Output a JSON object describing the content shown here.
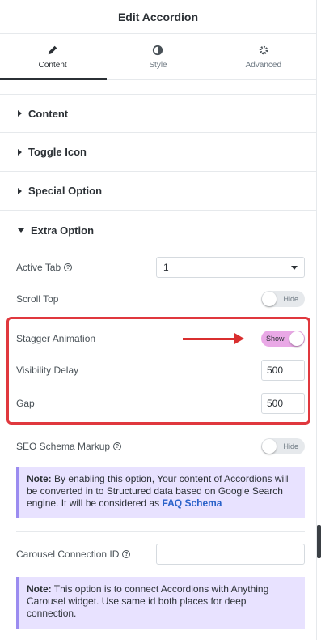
{
  "header": {
    "title": "Edit Accordion"
  },
  "tabs": [
    {
      "label": "Content",
      "icon": "pencil-icon"
    },
    {
      "label": "Style",
      "icon": "contrast-icon"
    },
    {
      "label": "Advanced",
      "icon": "gear-icon"
    }
  ],
  "sections": {
    "content": "Content",
    "toggle_icon": "Toggle Icon",
    "special_option": "Special Option",
    "extra_option": "Extra Option"
  },
  "controls": {
    "active_tab_label": "Active Tab",
    "active_tab_value": "1",
    "scroll_top_label": "Scroll Top",
    "scroll_top_state": "Hide",
    "stagger_label": "Stagger Animation",
    "stagger_state": "Show",
    "visibility_delay_label": "Visibility Delay",
    "visibility_delay_value": "500",
    "gap_label": "Gap",
    "gap_value": "500",
    "seo_label": "SEO Schema Markup",
    "seo_state": "Hide",
    "carousel_label": "Carousel Connection ID",
    "carousel_value": ""
  },
  "notes": {
    "seo_prefix": "Note:",
    "seo_text": " By enabling this option, Your content of Accordions will be converted in to Structured data based on Google Search engine. It will be considered as ",
    "seo_link": "FAQ Schema",
    "carousel_prefix": "Note:",
    "carousel_text": " This option is to connect Accordions with Anything Carousel widget. Use same id both places for deep connection."
  },
  "help_glyph": "?",
  "colors": {
    "highlight": "#e0383e",
    "switch_on": "#e9a8e6",
    "note_bg": "#e8e2ff",
    "link": "#2a62c9"
  }
}
